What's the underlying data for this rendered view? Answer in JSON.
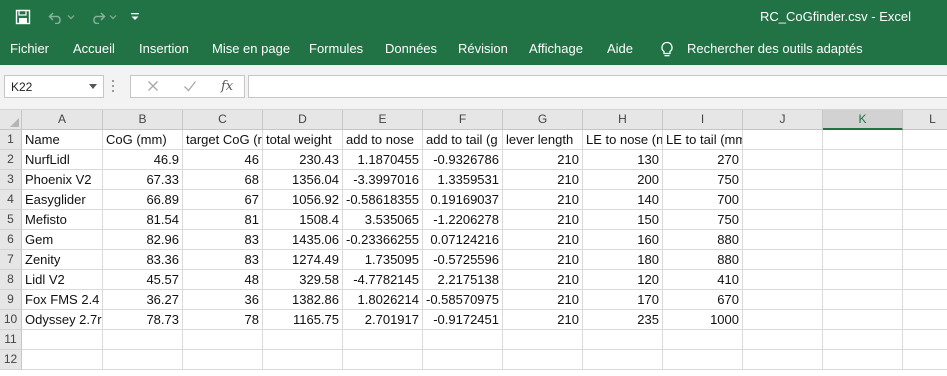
{
  "title": {
    "file": "RC_CoGfinder.csv",
    "separator": "-",
    "app": "Excel",
    "full": "RC_CoGfinder.csv  -  Excel"
  },
  "quick_access": {
    "save_icon": "save-icon",
    "undo_icon": "undo-icon",
    "redo_icon": "redo-icon",
    "customize_icon": "customize-qat-icon"
  },
  "ribbon": {
    "tabs": [
      "Fichier",
      "Accueil",
      "Insertion",
      "Mise en page",
      "Formules",
      "Données",
      "Révision",
      "Affichage",
      "Aide"
    ],
    "tell_me": "Rechercher des outils adaptés",
    "tell_me_icon": "lightbulb-icon"
  },
  "formula_bar": {
    "name_box": "K22",
    "cancel_icon": "cancel-x-icon",
    "enter_icon": "check-icon",
    "fx_label": "fx",
    "content": ""
  },
  "sheet": {
    "columns": [
      "A",
      "B",
      "C",
      "D",
      "E",
      "F",
      "G",
      "H",
      "I",
      "J",
      "K",
      "L"
    ],
    "selected_column": "K",
    "rows": [
      "1",
      "2",
      "3",
      "4",
      "5",
      "6",
      "7",
      "8",
      "9",
      "10",
      "11",
      "12"
    ],
    "cells": [
      [
        "Name",
        "CoG (mm)",
        "target CoG (r",
        "total weight",
        "add  to nose",
        "add to tail (g",
        "lever length",
        "LE to nose (n",
        "LE to tail (mm)",
        "",
        "",
        ""
      ],
      [
        "NurfLidl",
        "46.9",
        "46",
        "230.43",
        "1.1870455",
        "-0.9326786",
        "210",
        "130",
        "270",
        "",
        "",
        ""
      ],
      [
        "Phoenix V2",
        "67.33",
        "68",
        "1356.04",
        "-3.3997016",
        "1.3359531",
        "210",
        "200",
        "750",
        "",
        "",
        ""
      ],
      [
        "Easyglider",
        "66.89",
        "67",
        "1056.92",
        "-0.58618355",
        "0.19169037",
        "210",
        "140",
        "700",
        "",
        "",
        ""
      ],
      [
        "Mefisto",
        "81.54",
        "81",
        "1508.4",
        "3.535065",
        "-1.2206278",
        "210",
        "150",
        "750",
        "",
        "",
        ""
      ],
      [
        "Gem",
        "82.96",
        "83",
        "1435.06",
        "-0.23366255",
        "0.07124216",
        "210",
        "160",
        "880",
        "",
        "",
        ""
      ],
      [
        "Zenity",
        "83.36",
        "83",
        "1274.49",
        "1.735095",
        "-0.5725596",
        "210",
        "180",
        "880",
        "",
        "",
        ""
      ],
      [
        "Lidl V2",
        "45.57",
        "48",
        "329.58",
        "-4.7782145",
        "2.2175138",
        "210",
        "120",
        "410",
        "",
        "",
        ""
      ],
      [
        "Fox FMS 2.4",
        "36.27",
        "36",
        "1382.86",
        "1.8026214",
        "-0.58570975",
        "210",
        "170",
        "670",
        "",
        "",
        ""
      ],
      [
        "Odyssey 2.7r",
        "78.73",
        "78",
        "1165.75",
        "2.701917",
        "-0.9172451",
        "210",
        "235",
        "1000",
        "",
        "",
        ""
      ],
      [
        "",
        "",
        "",
        "",
        "",
        "",
        "",
        "",
        "",
        "",
        "",
        ""
      ],
      [
        "",
        "",
        "",
        "",
        "",
        "",
        "",
        "",
        "",
        "",
        "",
        ""
      ]
    ]
  }
}
